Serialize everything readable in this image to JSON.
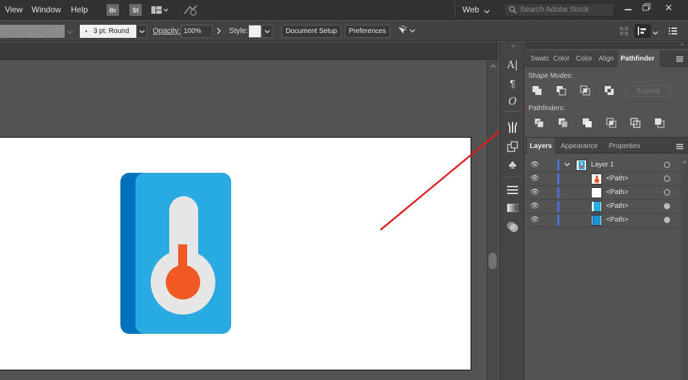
{
  "menubar": {
    "items": [
      "View",
      "Window",
      "Help"
    ],
    "bridge_label": "Br",
    "stock_label": "St",
    "workspace": "Web",
    "search_placeholder": "Search Adobe Stock"
  },
  "controlbar": {
    "stroke_profile": "3 pt. Round",
    "opacity_label": "Opacity:",
    "opacity_value": "100%",
    "style_label": "Style:",
    "document_setup": "Document Setup",
    "preferences": "Preferences"
  },
  "panels": {
    "top_tabs": [
      "Swatc",
      "Color",
      "Color",
      "Align",
      "Pathfinder"
    ],
    "shape_modes_label": "Shape Modes:",
    "expand_label": "Expand",
    "pathfinders_label": "Pathfinders:",
    "bottom_tabs": [
      "Layers",
      "Appearance",
      "Properties"
    ],
    "layers": [
      {
        "name": "Layer 1",
        "thumb": "layer"
      },
      {
        "name": "<Path>",
        "thumb": "orange"
      },
      {
        "name": "<Path>",
        "thumb": "white"
      },
      {
        "name": "<Path>",
        "thumb": "blue"
      },
      {
        "name": "<Path>",
        "thumb": "darkblue"
      }
    ]
  },
  "colors": {
    "thermo_dark_blue": "#0071bc",
    "thermo_light_blue": "#29abe2",
    "thermo_gray": "#e6e6e6",
    "thermo_orange": "#f15a24",
    "arrow_red": "#e01b1b",
    "layer_bar": "#4a6fe0"
  }
}
